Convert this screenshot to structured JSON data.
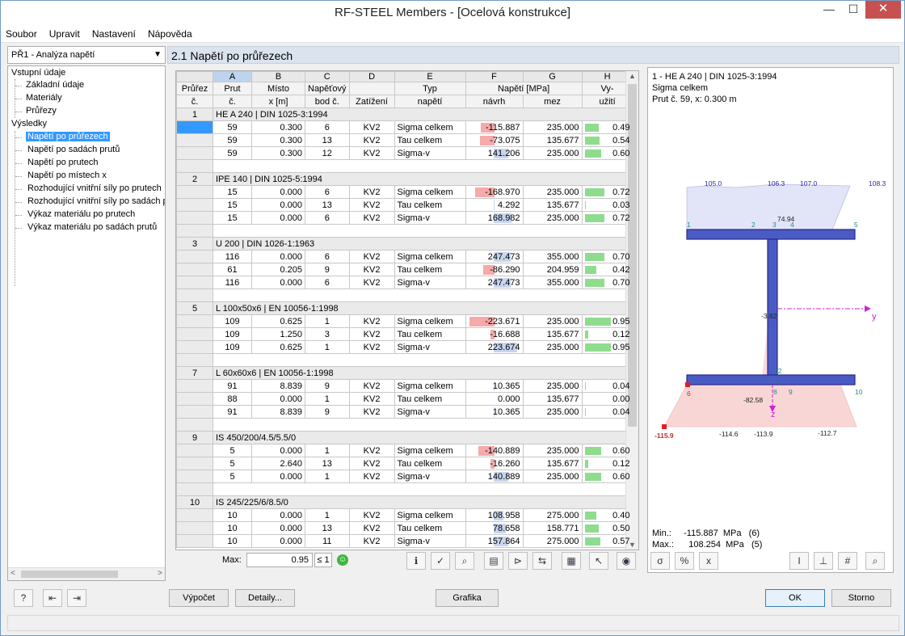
{
  "window": {
    "title": "RF-STEEL Members - [Ocelová konstrukce]",
    "close": "✕",
    "minimize": "—",
    "maximize": "☐"
  },
  "menu": [
    "Soubor",
    "Upravit",
    "Nastavení",
    "Nápověda"
  ],
  "case_select": "PŘ1 - Analýza napětí",
  "tree": {
    "input_group": "Vstupní údaje",
    "input_items": [
      "Základní údaje",
      "Materiály",
      "Průřezy"
    ],
    "results_group": "Výsledky",
    "result_items": [
      "Napětí po průřezech",
      "Napětí po sadách prutů",
      "Napětí po prutech",
      "Napětí po místech x",
      "Rozhodující vnitřní síly po prutech",
      "Rozhodující vnitřní síly po sadách p",
      "Výkaz materiálu po prutech",
      "Výkaz materiálu po sadách prutů"
    ],
    "selected": 0
  },
  "section_title": "2.1 Napětí po průřezech",
  "table": {
    "col_letters": [
      "A",
      "B",
      "C",
      "D",
      "E",
      "F",
      "G",
      "H"
    ],
    "hdr1": [
      "Průřez",
      "Prut",
      "Místo",
      "Napěťový",
      "",
      "Typ",
      "Napětí [MPa]",
      "",
      "Vy-"
    ],
    "hdr2": [
      "č.",
      "č.",
      "x [m]",
      "bod č.",
      "Zatížení",
      "napětí",
      "návrh",
      "mez",
      "užití"
    ],
    "groups": [
      {
        "no": "1",
        "name": "HE A 240 | DIN 1025-3:1994",
        "rows": [
          {
            "member": "59",
            "x": "0.300",
            "pt": "6",
            "lc": "KV2",
            "type": "Sigma celkem",
            "sigma": "-115.887",
            "limit": "235.000",
            "ratio": "0.49"
          },
          {
            "member": "59",
            "x": "0.300",
            "pt": "13",
            "lc": "KV2",
            "type": "Tau celkem",
            "sigma": "-73.075",
            "limit": "135.677",
            "ratio": "0.54"
          },
          {
            "member": "59",
            "x": "0.300",
            "pt": "12",
            "lc": "KV2",
            "type": "Sigma-v",
            "sigma": "141.206",
            "limit": "235.000",
            "ratio": "0.60"
          }
        ]
      },
      {
        "no": "2",
        "name": "IPE 140 | DIN 1025-5:1994",
        "rows": [
          {
            "member": "15",
            "x": "0.000",
            "pt": "6",
            "lc": "KV2",
            "type": "Sigma celkem",
            "sigma": "-168.970",
            "limit": "235.000",
            "ratio": "0.72"
          },
          {
            "member": "15",
            "x": "0.000",
            "pt": "13",
            "lc": "KV2",
            "type": "Tau celkem",
            "sigma": "4.292",
            "limit": "135.677",
            "ratio": "0.03"
          },
          {
            "member": "15",
            "x": "0.000",
            "pt": "6",
            "lc": "KV2",
            "type": "Sigma-v",
            "sigma": "168.982",
            "limit": "235.000",
            "ratio": "0.72"
          }
        ]
      },
      {
        "no": "3",
        "name": "U 200 | DIN 1026-1:1963",
        "rows": [
          {
            "member": "116",
            "x": "0.000",
            "pt": "6",
            "lc": "KV2",
            "type": "Sigma celkem",
            "sigma": "247.473",
            "limit": "355.000",
            "ratio": "0.70"
          },
          {
            "member": "61",
            "x": "0.205",
            "pt": "9",
            "lc": "KV2",
            "type": "Tau celkem",
            "sigma": "-86.290",
            "limit": "204.959",
            "ratio": "0.42"
          },
          {
            "member": "116",
            "x": "0.000",
            "pt": "6",
            "lc": "KV2",
            "type": "Sigma-v",
            "sigma": "247.473",
            "limit": "355.000",
            "ratio": "0.70"
          }
        ]
      },
      {
        "no": "5",
        "name": "L 100x50x6 | EN 10056-1:1998",
        "rows": [
          {
            "member": "109",
            "x": "0.625",
            "pt": "1",
            "lc": "KV2",
            "type": "Sigma celkem",
            "sigma": "-223.671",
            "limit": "235.000",
            "ratio": "0.95"
          },
          {
            "member": "109",
            "x": "1.250",
            "pt": "3",
            "lc": "KV2",
            "type": "Tau celkem",
            "sigma": "-16.688",
            "limit": "135.677",
            "ratio": "0.12"
          },
          {
            "member": "109",
            "x": "0.625",
            "pt": "1",
            "lc": "KV2",
            "type": "Sigma-v",
            "sigma": "223.674",
            "limit": "235.000",
            "ratio": "0.95"
          }
        ]
      },
      {
        "no": "7",
        "name": "L 60x60x6 | EN 10056-1:1998",
        "rows": [
          {
            "member": "91",
            "x": "8.839",
            "pt": "9",
            "lc": "KV2",
            "type": "Sigma celkem",
            "sigma": "10.365",
            "limit": "235.000",
            "ratio": "0.04"
          },
          {
            "member": "88",
            "x": "0.000",
            "pt": "1",
            "lc": "KV2",
            "type": "Tau celkem",
            "sigma": "0.000",
            "limit": "135.677",
            "ratio": "0.00"
          },
          {
            "member": "91",
            "x": "8.839",
            "pt": "9",
            "lc": "KV2",
            "type": "Sigma-v",
            "sigma": "10.365",
            "limit": "235.000",
            "ratio": "0.04"
          }
        ]
      },
      {
        "no": "9",
        "name": "IS 450/200/4.5/5.5/0",
        "rows": [
          {
            "member": "5",
            "x": "0.000",
            "pt": "1",
            "lc": "KV2",
            "type": "Sigma celkem",
            "sigma": "-140.889",
            "limit": "235.000",
            "ratio": "0.60"
          },
          {
            "member": "5",
            "x": "2.640",
            "pt": "13",
            "lc": "KV2",
            "type": "Tau celkem",
            "sigma": "-16.260",
            "limit": "135.677",
            "ratio": "0.12"
          },
          {
            "member": "5",
            "x": "0.000",
            "pt": "1",
            "lc": "KV2",
            "type": "Sigma-v",
            "sigma": "140.889",
            "limit": "235.000",
            "ratio": "0.60"
          }
        ]
      },
      {
        "no": "10",
        "name": "IS 245/225/6/8.5/0",
        "rows": [
          {
            "member": "10",
            "x": "0.000",
            "pt": "1",
            "lc": "KV2",
            "type": "Sigma celkem",
            "sigma": "108.958",
            "limit": "275.000",
            "ratio": "0.40"
          },
          {
            "member": "10",
            "x": "0.000",
            "pt": "13",
            "lc": "KV2",
            "type": "Tau celkem",
            "sigma": "78.658",
            "limit": "158.771",
            "ratio": "0.50"
          },
          {
            "member": "10",
            "x": "0.000",
            "pt": "11",
            "lc": "KV2",
            "type": "Sigma-v",
            "sigma": "157.864",
            "limit": "275.000",
            "ratio": "0.57"
          }
        ]
      }
    ]
  },
  "table_toolbar": {
    "max_label": "Max:",
    "max_value": "0.95",
    "le": "≤ 1"
  },
  "graphic": {
    "info": [
      "1 - HE A 240 | DIN 1025-3:1994",
      "Sigma celkem",
      "Prut č. 59, x: 0.300 m"
    ],
    "top_values": [
      "105.0",
      "106.3",
      "107.0",
      "108.3"
    ],
    "top_points": [
      "1",
      "2",
      "3",
      "4",
      "5"
    ],
    "web_values": [
      "74.94",
      "-3.82",
      "12",
      "-82.58"
    ],
    "bottom_points": [
      "6",
      "8",
      "9",
      "10"
    ],
    "bottom_values": [
      "-115.9",
      "-114.6",
      "-113.9",
      "-112.7"
    ],
    "axis_y": "y",
    "axis_z": "z",
    "min_label": "Min.:",
    "min_value": "-115.887",
    "min_unit": "MPa",
    "min_pt": "(6)",
    "max_label": "Max.:",
    "max_value": "108.254",
    "max_unit": "MPa",
    "max_pt": "(5)"
  },
  "buttons": {
    "calc": "Výpočet",
    "details": "Detaily...",
    "graphics": "Grafika",
    "ok": "OK",
    "cancel": "Storno"
  },
  "colors": {
    "neg_bar": "#f6aaaa",
    "ratio_bar": "#8fdc8f",
    "selected": "#3399ff",
    "section_fill": "#4a5bc4"
  }
}
